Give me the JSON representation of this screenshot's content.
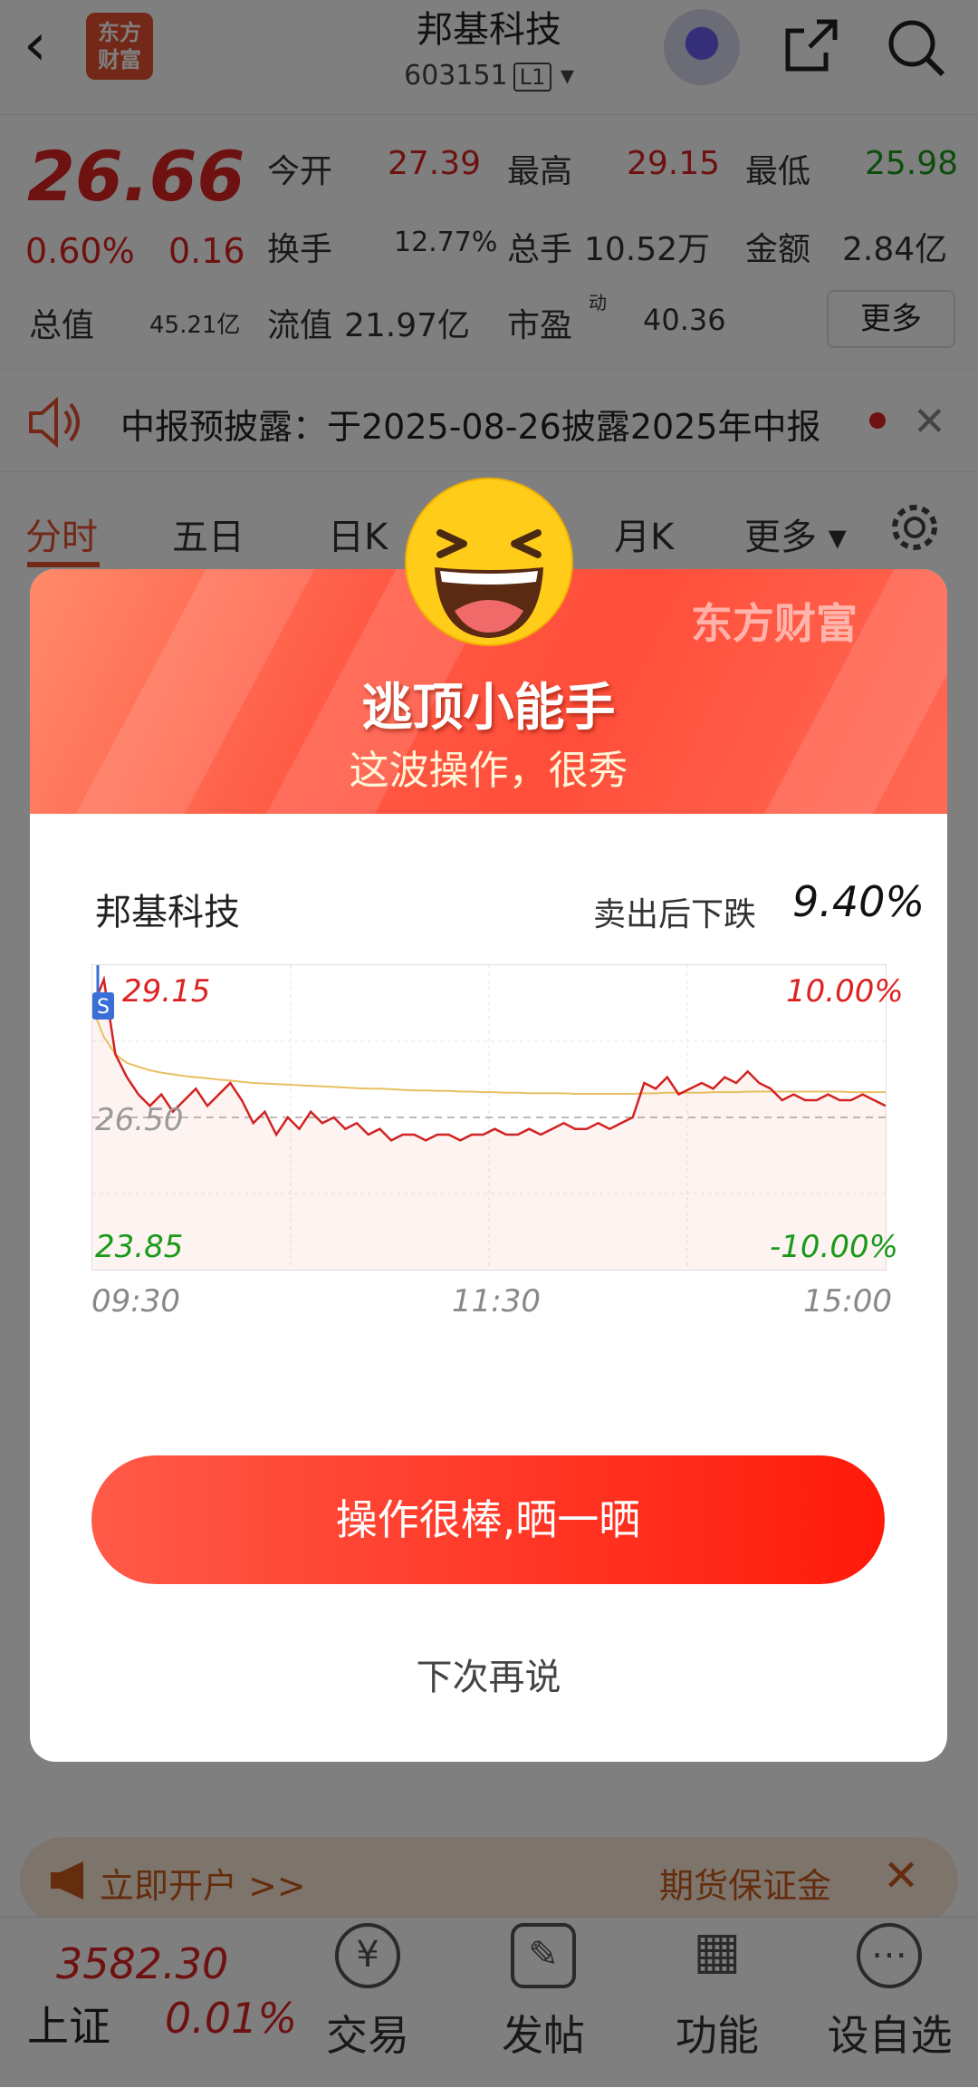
{
  "header": {
    "back_icon": "chevron-left-icon",
    "logo_text": "东方财富",
    "stock_name": "邦基科技",
    "stock_code": "603151",
    "code_tag": "L1"
  },
  "quote": {
    "price": "26.66",
    "change_pct": "0.60%",
    "change_amt": "0.16",
    "open_label": "今开",
    "open": "27.39",
    "high_label": "最高",
    "high": "29.15",
    "low_label": "最低",
    "low": "25.98",
    "turnover_label": "换手",
    "turnover": "12.77%",
    "volume_label": "总手",
    "volume": "10.52万",
    "amount_label": "金额",
    "amount": "2.84亿",
    "mktcap_label": "总值",
    "mktcap": "45.21亿",
    "float_label": "流值",
    "float": "21.97亿",
    "pe_label": "市盈",
    "pe_sup": "动",
    "pe": "40.36",
    "more_label": "更多"
  },
  "notice": {
    "text": "中报预披露：于2025-08-26披露2025年中报"
  },
  "tabs": [
    "分时",
    "五日",
    "日K",
    "月K",
    "更多"
  ],
  "modal": {
    "brand": "东方财富",
    "title": "逃顶小能手",
    "subtitle": "这波操作，很秀",
    "stock_name": "邦基科技",
    "drop_label": "卖出后下跌",
    "drop_value": "9.40%",
    "share_button": "操作很棒,晒一晒",
    "later_link": "下次再说"
  },
  "chart_data": {
    "type": "line",
    "title": "",
    "x_labels": [
      "09:30",
      "11:30",
      "15:00"
    ],
    "y_max": "29.15",
    "y_mid": "26.50",
    "y_min": "23.85",
    "pct_max": "10.00%",
    "pct_min": "-10.00%",
    "ylim": [
      23.85,
      29.15
    ],
    "sell_marker": "S",
    "series": [
      {
        "values": [
          28.4,
          28.9,
          27.6,
          27.2,
          26.9,
          26.7,
          26.9,
          26.6,
          26.8,
          27.0,
          26.7,
          26.9,
          27.1,
          26.8,
          26.4,
          26.6,
          26.2,
          26.5,
          26.3,
          26.6,
          26.4,
          26.5,
          26.3,
          26.4,
          26.2,
          26.3,
          26.1,
          26.2,
          26.2,
          26.1,
          26.2,
          26.2,
          26.1,
          26.2,
          26.2,
          26.3,
          26.2,
          26.2,
          26.3,
          26.2,
          26.3,
          26.4,
          26.3,
          26.3,
          26.4,
          26.3,
          26.4,
          26.5,
          27.1,
          27.0,
          27.2,
          26.9,
          27.0,
          27.1,
          27.0,
          27.2,
          27.1,
          27.3,
          27.1,
          27.0,
          26.8,
          26.9,
          26.8,
          26.8,
          26.9,
          26.8,
          26.8,
          26.9,
          26.8,
          26.7
        ]
      },
      {
        "values": [
          28.4,
          27.9,
          27.6,
          27.45,
          27.38,
          27.32,
          27.28,
          27.25,
          27.22,
          27.2,
          27.18,
          27.16,
          27.14,
          27.12,
          27.1,
          27.09,
          27.08,
          27.07,
          27.06,
          27.05,
          27.04,
          27.03,
          27.02,
          27.01,
          27.0,
          27.0,
          26.99,
          26.98,
          26.97,
          26.97,
          26.96,
          26.96,
          26.95,
          26.95,
          26.94,
          26.94,
          26.93,
          26.93,
          26.92,
          26.92,
          26.92,
          26.92,
          26.91,
          26.91,
          26.91,
          26.91,
          26.91,
          26.91,
          26.92,
          26.92,
          26.93,
          26.93,
          26.93,
          26.93,
          26.94,
          26.94,
          26.94,
          26.95,
          26.95,
          26.95,
          26.95,
          26.95,
          26.95,
          26.95,
          26.95,
          26.95,
          26.94,
          26.94,
          26.94,
          26.94
        ]
      }
    ]
  },
  "bottom_nav": {
    "index_value": "3582.30",
    "index_name": "上证",
    "index_pct": "0.01%",
    "items": [
      {
        "label": "交易",
        "icon": "yen-icon"
      },
      {
        "label": "发帖",
        "icon": "edit-icon"
      },
      {
        "label": "功能",
        "icon": "grid-icon"
      },
      {
        "label": "设自选",
        "icon": "more-icon"
      }
    ]
  },
  "banner": {
    "left_text": "立即开户 >>",
    "right_text": "期货保证金"
  },
  "colors": {
    "accent": "#e8502f",
    "up": "#d22222",
    "down": "#1a9a1a",
    "avg_line": "#e8c060"
  }
}
